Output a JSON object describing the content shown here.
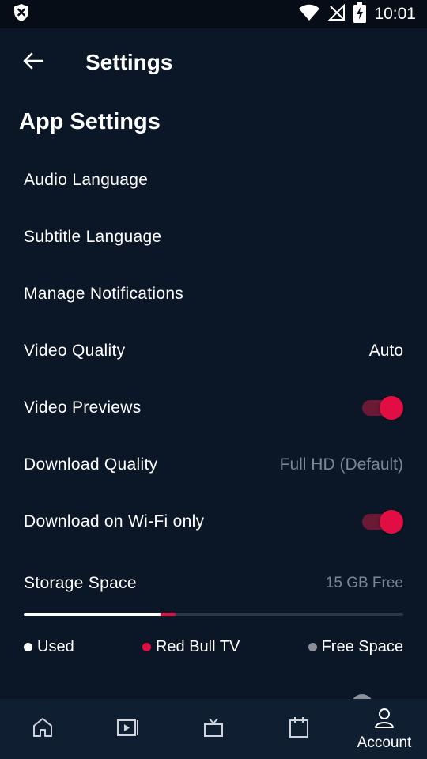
{
  "status": {
    "time": "10:01",
    "icons": [
      "shield-x-icon",
      "wifi-icon",
      "no-signal-icon",
      "battery-charging-icon"
    ]
  },
  "header": {
    "title": "Settings",
    "back_icon": "arrow-left-icon"
  },
  "section": {
    "title": "App Settings"
  },
  "settings": [
    {
      "label": "Audio Language"
    },
    {
      "label": "Subtitle Language"
    },
    {
      "label": "Manage Notifications"
    },
    {
      "label": "Video Quality",
      "value": "Auto"
    },
    {
      "label": "Video Previews",
      "toggle": true
    },
    {
      "label": "Download Quality",
      "value": "Full HD (Default)"
    },
    {
      "label": "Download on Wi-Fi only",
      "toggle": true
    }
  ],
  "storage": {
    "label": "Storage Space",
    "free_text": "15 GB Free",
    "used_fraction": 0.36,
    "redbulltv_fraction": 0.04,
    "legend": [
      {
        "label": "Used",
        "color": "#ffffff"
      },
      {
        "label": "Red Bull TV",
        "color": "#e20d42"
      },
      {
        "label": "Free Space",
        "color": "#8a8f99"
      }
    ]
  },
  "colors": {
    "background": "#0b1727",
    "accent": "#e20d42",
    "muted_text": "#7c8594",
    "nav_background": "#0f1e31"
  },
  "bottom_nav": [
    {
      "icon": "home-icon"
    },
    {
      "icon": "play-library-icon"
    },
    {
      "icon": "tv-icon"
    },
    {
      "icon": "calendar-icon"
    },
    {
      "icon": "account-icon",
      "label": "Account",
      "active": true
    }
  ]
}
